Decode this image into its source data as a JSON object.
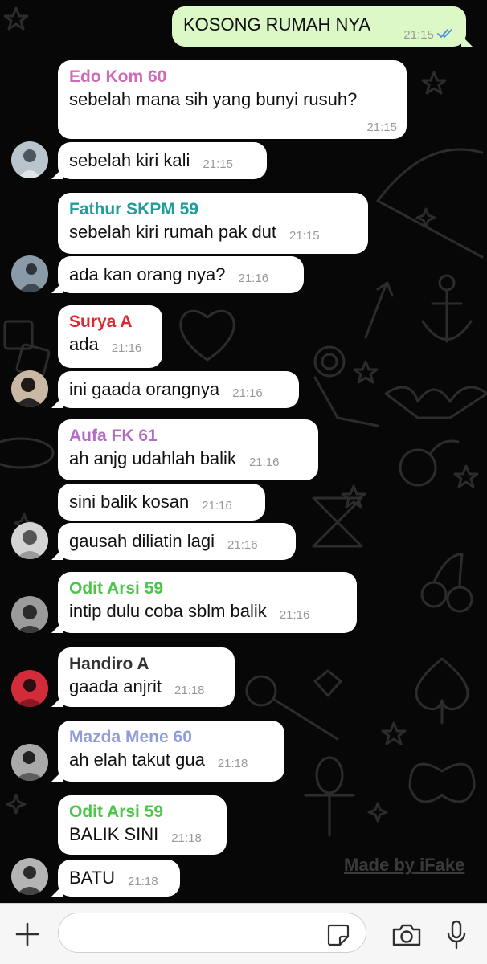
{
  "messages": [
    {
      "direction": "outgoing",
      "text": "KOSONG RUMAH NYA",
      "time": "21:15",
      "status": "read",
      "status_color": "#4a90e2"
    },
    {
      "sender": "Edo Kom 60",
      "sender_color": "#d06ab8",
      "text": "sebelah mana sih yang bunyi rusuh?",
      "time": "21:15"
    },
    {
      "text": "sebelah kiri kali",
      "time": "21:15"
    },
    {
      "sender": "Fathur SKPM 59",
      "sender_color": "#1e9e9a",
      "text": "sebelah kiri rumah pak dut",
      "time": "21:15"
    },
    {
      "text": "ada kan orang nya?",
      "time": "21:16"
    },
    {
      "sender": "Surya A",
      "sender_color": "#d9282f",
      "text": "ada",
      "time": "21:16"
    },
    {
      "text": "ini gaada orangnya",
      "time": "21:16"
    },
    {
      "sender": "Aufa FK 61",
      "sender_color": "#b26cc6",
      "text": "ah anjg udahlah balik",
      "time": "21:16"
    },
    {
      "text": "sini balik kosan",
      "time": "21:16"
    },
    {
      "text": "gausah diliatin lagi",
      "time": "21:16"
    },
    {
      "sender": "Odit Arsi 59",
      "sender_color": "#4dc44a",
      "text": "intip dulu coba sblm balik",
      "time": "21:16"
    },
    {
      "sender": "Handiro A",
      "sender_color": "#333333",
      "text": "gaada anjrit",
      "time": "21:18"
    },
    {
      "sender": "Mazda Mene 60",
      "sender_color": "#8f9ed8",
      "text": "ah elah takut gua",
      "time": "21:18"
    },
    {
      "sender": "Odit Arsi 59",
      "sender_color": "#4dc44a",
      "text": "BALIK SINI",
      "time": "21:18"
    },
    {
      "text": "BATU",
      "time": "21:18"
    }
  ],
  "watermark": "Made by iFake",
  "input_bar": {
    "add_icon": "plus-icon",
    "sticker_icon": "sticker-icon",
    "camera_icon": "camera-icon",
    "mic_icon": "microphone-icon",
    "message_value": ""
  },
  "colors": {
    "background": "#070707",
    "incoming_bubble": "#ffffff",
    "outgoing_bubble": "#dcf8c6",
    "timestamp": "#999999",
    "input_bar": "#f6f6f6"
  }
}
